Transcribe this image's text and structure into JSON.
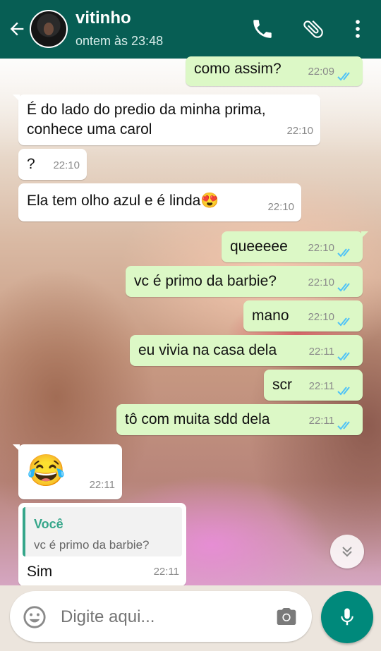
{
  "header": {
    "title": "vitinho",
    "subtitle": "ontem às 23:48",
    "icons": [
      "back-arrow-icon",
      "phone-icon",
      "paperclip-icon",
      "more-vert-icon"
    ]
  },
  "messages": [
    {
      "dir": "out",
      "text": "como assim?",
      "time": "22:09",
      "status": "read"
    },
    {
      "dir": "in",
      "line1": "É do lado do predio da minha prima,",
      "line2": "conhece uma carol",
      "time": "22:10"
    },
    {
      "dir": "in",
      "text": "?",
      "time": "22:10"
    },
    {
      "dir": "in",
      "text": "Ela tem olho azul e é linda",
      "emoji": "😍",
      "time": "22:10"
    },
    {
      "dir": "out",
      "text": "queeeee",
      "time": "22:10",
      "status": "read"
    },
    {
      "dir": "out",
      "text": "vc é primo da barbie?",
      "time": "22:10",
      "status": "read"
    },
    {
      "dir": "out",
      "text": "mano",
      "time": "22:10",
      "status": "read"
    },
    {
      "dir": "out",
      "text": "eu vivia na casa dela",
      "time": "22:11",
      "status": "read"
    },
    {
      "dir": "out",
      "text": "scr",
      "time": "22:11",
      "status": "read"
    },
    {
      "dir": "out",
      "text": "tô com muita sdd dela",
      "time": "22:11",
      "status": "read"
    },
    {
      "dir": "in",
      "emoji": "😂",
      "time": "22:11"
    },
    {
      "dir": "in",
      "quote_name": "Você",
      "quote_text": "vc é primo da barbie?",
      "text": "Sim",
      "time": "22:11"
    }
  ],
  "input": {
    "placeholder": "Digite aqui..."
  },
  "colors": {
    "header": "#075e54",
    "outgoing_bubble": "#dcf8c6",
    "incoming_bubble": "#ffffff",
    "read_ticks": "#4fc3f7",
    "mic_button": "#00897b"
  }
}
